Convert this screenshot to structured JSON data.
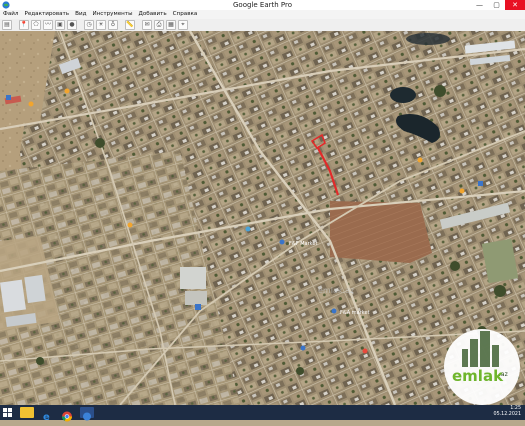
{
  "window": {
    "title": "Google Earth Pro",
    "controls": {
      "minimize": "—",
      "maximize": "▢",
      "close": "✕"
    }
  },
  "menu": [
    "Файл",
    "Редактировать",
    "Вид",
    "Инструменты",
    "Добавить",
    "Справка"
  ],
  "map": {
    "labels": [
      {
        "text": "F&F Market",
        "name": "map-label-ff-market"
      },
      {
        "text": "emlak.az",
        "name": "map-label-emlak-watermark"
      },
      {
        "text": "F&A market",
        "name": "map-label-fa-market"
      }
    ],
    "route_color": "#e22a2a"
  },
  "watermark": {
    "brand": "emlak",
    "suffix": ".az",
    "colors": {
      "green": "#6fb52c",
      "dark": "#2f4c25"
    }
  },
  "taskbar": {
    "time": "1:25",
    "date": "05.12.2021"
  }
}
